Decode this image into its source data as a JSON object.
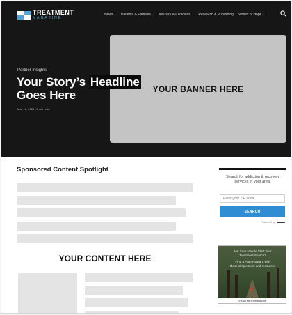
{
  "brand": {
    "name": "TREATMENT",
    "sub": "MAGAZINE"
  },
  "nav": {
    "items": [
      "News ⌄",
      "Patients & Families ⌄",
      "Industry & Clinicians ⌄",
      "Research & Publishing",
      "Stories of Hope ⌄"
    ]
  },
  "hero": {
    "kicker": "Partner Insights",
    "title_part1": "Your Story’s ",
    "title_part2": "Headline",
    "title_part3": "Goes Here",
    "meta": "May 17, 2021 | 3 min read",
    "banner_text": "YOUR BANNER HERE"
  },
  "main": {
    "section_title": "Sponsored Content Spotlight",
    "content_label": "YOUR CONTENT HERE"
  },
  "sidebar": {
    "description": "Search for addiction & recovery services in your area:",
    "zip_placeholder": "Enter your ZIP code",
    "search_label": "SEARCH",
    "powered_by": "Powered by"
  },
  "ad": {
    "line1": "Not Sure How to Start Your",
    "line2": "Treatment Search?",
    "line3": "Find a Path Forward with",
    "line4": "these simple tools and resources",
    "footer": "TREATMENTmagazine"
  },
  "colors": {
    "hero_bg": "#161616",
    "accent": "#2f8ed3",
    "logo_accent": "#4fa6d6",
    "placeholder": "#c4c4c4"
  }
}
